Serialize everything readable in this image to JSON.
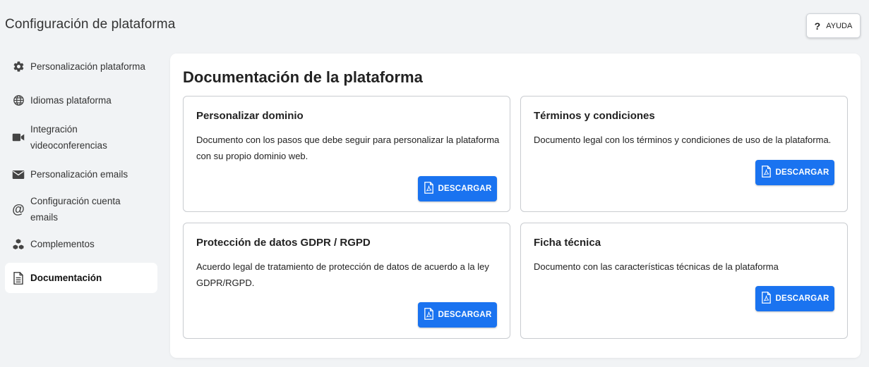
{
  "page": {
    "title": "Configuración de plataforma"
  },
  "help": {
    "label": "AYUDA",
    "icon": "question-icon"
  },
  "sidebar": {
    "items": [
      {
        "label": "Personalización plataforma",
        "icon": "gear-icon",
        "active": false
      },
      {
        "label": "Idiomas plataforma",
        "icon": "globe-icon",
        "active": false
      },
      {
        "label": "Integración videoconferencias",
        "icon": "video-camera-icon",
        "active": false
      },
      {
        "label": "Personalización emails",
        "icon": "envelope-icon",
        "active": false
      },
      {
        "label": "Configuración cuenta emails",
        "icon": "at-sign-icon",
        "active": false
      },
      {
        "label": "Complementos",
        "icon": "cubes-icon",
        "active": false
      },
      {
        "label": "Documentación",
        "icon": "document-icon",
        "active": true
      }
    ]
  },
  "main": {
    "title": "Documentación de la plataforma",
    "cards": [
      {
        "title": "Personalizar dominio",
        "description": "Documento con los pasos que debe seguir para personalizar la plataforma con su propio dominio web.",
        "button_label": "DESCARGAR"
      },
      {
        "title": "Términos y condiciones",
        "description": "Documento legal con los términos y condiciones de uso de la plataforma.",
        "button_label": "DESCARGAR"
      },
      {
        "title": "Protección de datos GDPR / RGPD",
        "description": "Acuerdo legal de tratamiento de protección de datos de acuerdo a la ley GDPR/RGPD.",
        "button_label": "DESCARGAR"
      },
      {
        "title": "Ficha técnica",
        "description": "Documento con las características técnicas de la plataforma",
        "button_label": "DESCARGAR"
      }
    ]
  },
  "colors": {
    "accent": "#1a73f0",
    "background": "#f1f3f5",
    "panel": "#ffffff"
  }
}
